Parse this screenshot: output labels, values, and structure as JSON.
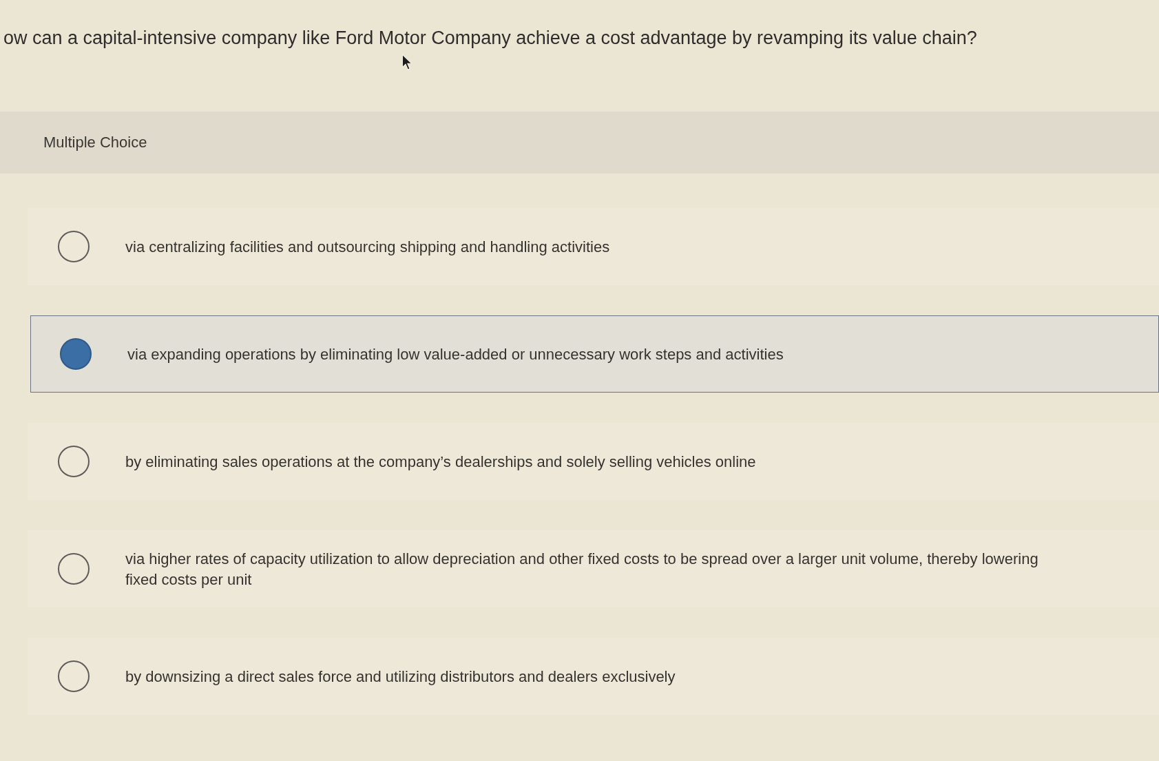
{
  "question": "ow can a capital-intensive company like Ford Motor Company achieve a cost advantage by revamping its value chain?",
  "section_label": "Multiple Choice",
  "options": [
    {
      "text": "via centralizing facilities and outsourcing shipping and handling activities",
      "selected": false
    },
    {
      "text": "via expanding operations by eliminating low value-added or unnecessary work steps and activities",
      "selected": true
    },
    {
      "text": "by eliminating sales operations at the company’s dealerships and solely selling vehicles online",
      "selected": false
    },
    {
      "text": "via higher rates of capacity utilization to allow depreciation and other fixed costs to be spread over a larger unit volume, thereby lowering fixed costs per unit",
      "selected": false
    },
    {
      "text": "by downsizing a direct sales force and utilizing distributors and dealers exclusively",
      "selected": false
    }
  ]
}
